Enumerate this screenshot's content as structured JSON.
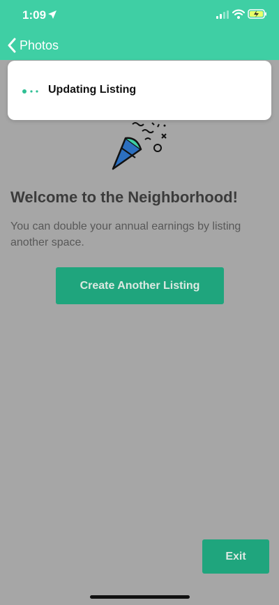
{
  "status_bar": {
    "time": "1:09",
    "battery_state": "charging"
  },
  "nav": {
    "back_label": "Photos"
  },
  "toast": {
    "text": "Updating Listing"
  },
  "content": {
    "title": "Welcome to the Neighborhood!",
    "description": "You can double your annual earnings by listing another space.",
    "create_button": "Create Another Listing",
    "exit_button": "Exit"
  },
  "colors": {
    "header_green": "#3fcfa4",
    "button_green": "#1fa57d",
    "overlay_gray": "#a6a6a6"
  },
  "icons": [
    "location-arrow-icon",
    "signal-icon",
    "wifi-icon",
    "battery-icon",
    "chevron-left-icon",
    "loading-dots-icon",
    "party-popper-icon"
  ]
}
